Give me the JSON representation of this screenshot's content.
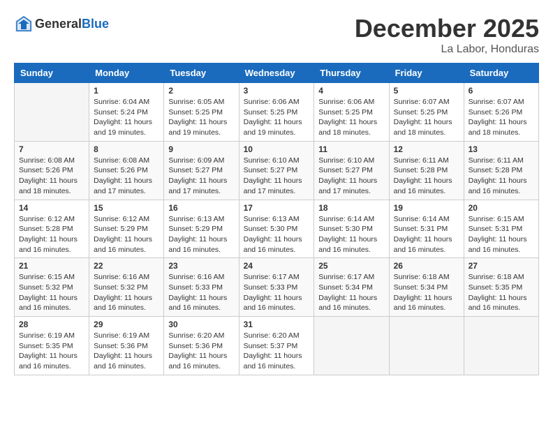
{
  "header": {
    "logo": {
      "general": "General",
      "blue": "Blue"
    },
    "title": "December 2025",
    "location": "La Labor, Honduras"
  },
  "calendar": {
    "days_of_week": [
      "Sunday",
      "Monday",
      "Tuesday",
      "Wednesday",
      "Thursday",
      "Friday",
      "Saturday"
    ],
    "weeks": [
      [
        {
          "day": "",
          "sunrise": "",
          "sunset": "",
          "daylight": ""
        },
        {
          "day": "1",
          "sunrise": "Sunrise: 6:04 AM",
          "sunset": "Sunset: 5:24 PM",
          "daylight": "Daylight: 11 hours and 19 minutes."
        },
        {
          "day": "2",
          "sunrise": "Sunrise: 6:05 AM",
          "sunset": "Sunset: 5:25 PM",
          "daylight": "Daylight: 11 hours and 19 minutes."
        },
        {
          "day": "3",
          "sunrise": "Sunrise: 6:06 AM",
          "sunset": "Sunset: 5:25 PM",
          "daylight": "Daylight: 11 hours and 19 minutes."
        },
        {
          "day": "4",
          "sunrise": "Sunrise: 6:06 AM",
          "sunset": "Sunset: 5:25 PM",
          "daylight": "Daylight: 11 hours and 18 minutes."
        },
        {
          "day": "5",
          "sunrise": "Sunrise: 6:07 AM",
          "sunset": "Sunset: 5:25 PM",
          "daylight": "Daylight: 11 hours and 18 minutes."
        },
        {
          "day": "6",
          "sunrise": "Sunrise: 6:07 AM",
          "sunset": "Sunset: 5:26 PM",
          "daylight": "Daylight: 11 hours and 18 minutes."
        }
      ],
      [
        {
          "day": "7",
          "sunrise": "Sunrise: 6:08 AM",
          "sunset": "Sunset: 5:26 PM",
          "daylight": "Daylight: 11 hours and 18 minutes."
        },
        {
          "day": "8",
          "sunrise": "Sunrise: 6:08 AM",
          "sunset": "Sunset: 5:26 PM",
          "daylight": "Daylight: 11 hours and 17 minutes."
        },
        {
          "day": "9",
          "sunrise": "Sunrise: 6:09 AM",
          "sunset": "Sunset: 5:27 PM",
          "daylight": "Daylight: 11 hours and 17 minutes."
        },
        {
          "day": "10",
          "sunrise": "Sunrise: 6:10 AM",
          "sunset": "Sunset: 5:27 PM",
          "daylight": "Daylight: 11 hours and 17 minutes."
        },
        {
          "day": "11",
          "sunrise": "Sunrise: 6:10 AM",
          "sunset": "Sunset: 5:27 PM",
          "daylight": "Daylight: 11 hours and 17 minutes."
        },
        {
          "day": "12",
          "sunrise": "Sunrise: 6:11 AM",
          "sunset": "Sunset: 5:28 PM",
          "daylight": "Daylight: 11 hours and 16 minutes."
        },
        {
          "day": "13",
          "sunrise": "Sunrise: 6:11 AM",
          "sunset": "Sunset: 5:28 PM",
          "daylight": "Daylight: 11 hours and 16 minutes."
        }
      ],
      [
        {
          "day": "14",
          "sunrise": "Sunrise: 6:12 AM",
          "sunset": "Sunset: 5:28 PM",
          "daylight": "Daylight: 11 hours and 16 minutes."
        },
        {
          "day": "15",
          "sunrise": "Sunrise: 6:12 AM",
          "sunset": "Sunset: 5:29 PM",
          "daylight": "Daylight: 11 hours and 16 minutes."
        },
        {
          "day": "16",
          "sunrise": "Sunrise: 6:13 AM",
          "sunset": "Sunset: 5:29 PM",
          "daylight": "Daylight: 11 hours and 16 minutes."
        },
        {
          "day": "17",
          "sunrise": "Sunrise: 6:13 AM",
          "sunset": "Sunset: 5:30 PM",
          "daylight": "Daylight: 11 hours and 16 minutes."
        },
        {
          "day": "18",
          "sunrise": "Sunrise: 6:14 AM",
          "sunset": "Sunset: 5:30 PM",
          "daylight": "Daylight: 11 hours and 16 minutes."
        },
        {
          "day": "19",
          "sunrise": "Sunrise: 6:14 AM",
          "sunset": "Sunset: 5:31 PM",
          "daylight": "Daylight: 11 hours and 16 minutes."
        },
        {
          "day": "20",
          "sunrise": "Sunrise: 6:15 AM",
          "sunset": "Sunset: 5:31 PM",
          "daylight": "Daylight: 11 hours and 16 minutes."
        }
      ],
      [
        {
          "day": "21",
          "sunrise": "Sunrise: 6:15 AM",
          "sunset": "Sunset: 5:32 PM",
          "daylight": "Daylight: 11 hours and 16 minutes."
        },
        {
          "day": "22",
          "sunrise": "Sunrise: 6:16 AM",
          "sunset": "Sunset: 5:32 PM",
          "daylight": "Daylight: 11 hours and 16 minutes."
        },
        {
          "day": "23",
          "sunrise": "Sunrise: 6:16 AM",
          "sunset": "Sunset: 5:33 PM",
          "daylight": "Daylight: 11 hours and 16 minutes."
        },
        {
          "day": "24",
          "sunrise": "Sunrise: 6:17 AM",
          "sunset": "Sunset: 5:33 PM",
          "daylight": "Daylight: 11 hours and 16 minutes."
        },
        {
          "day": "25",
          "sunrise": "Sunrise: 6:17 AM",
          "sunset": "Sunset: 5:34 PM",
          "daylight": "Daylight: 11 hours and 16 minutes."
        },
        {
          "day": "26",
          "sunrise": "Sunrise: 6:18 AM",
          "sunset": "Sunset: 5:34 PM",
          "daylight": "Daylight: 11 hours and 16 minutes."
        },
        {
          "day": "27",
          "sunrise": "Sunrise: 6:18 AM",
          "sunset": "Sunset: 5:35 PM",
          "daylight": "Daylight: 11 hours and 16 minutes."
        }
      ],
      [
        {
          "day": "28",
          "sunrise": "Sunrise: 6:19 AM",
          "sunset": "Sunset: 5:35 PM",
          "daylight": "Daylight: 11 hours and 16 minutes."
        },
        {
          "day": "29",
          "sunrise": "Sunrise: 6:19 AM",
          "sunset": "Sunset: 5:36 PM",
          "daylight": "Daylight: 11 hours and 16 minutes."
        },
        {
          "day": "30",
          "sunrise": "Sunrise: 6:20 AM",
          "sunset": "Sunset: 5:36 PM",
          "daylight": "Daylight: 11 hours and 16 minutes."
        },
        {
          "day": "31",
          "sunrise": "Sunrise: 6:20 AM",
          "sunset": "Sunset: 5:37 PM",
          "daylight": "Daylight: 11 hours and 16 minutes."
        },
        {
          "day": "",
          "sunrise": "",
          "sunset": "",
          "daylight": ""
        },
        {
          "day": "",
          "sunrise": "",
          "sunset": "",
          "daylight": ""
        },
        {
          "day": "",
          "sunrise": "",
          "sunset": "",
          "daylight": ""
        }
      ]
    ]
  }
}
